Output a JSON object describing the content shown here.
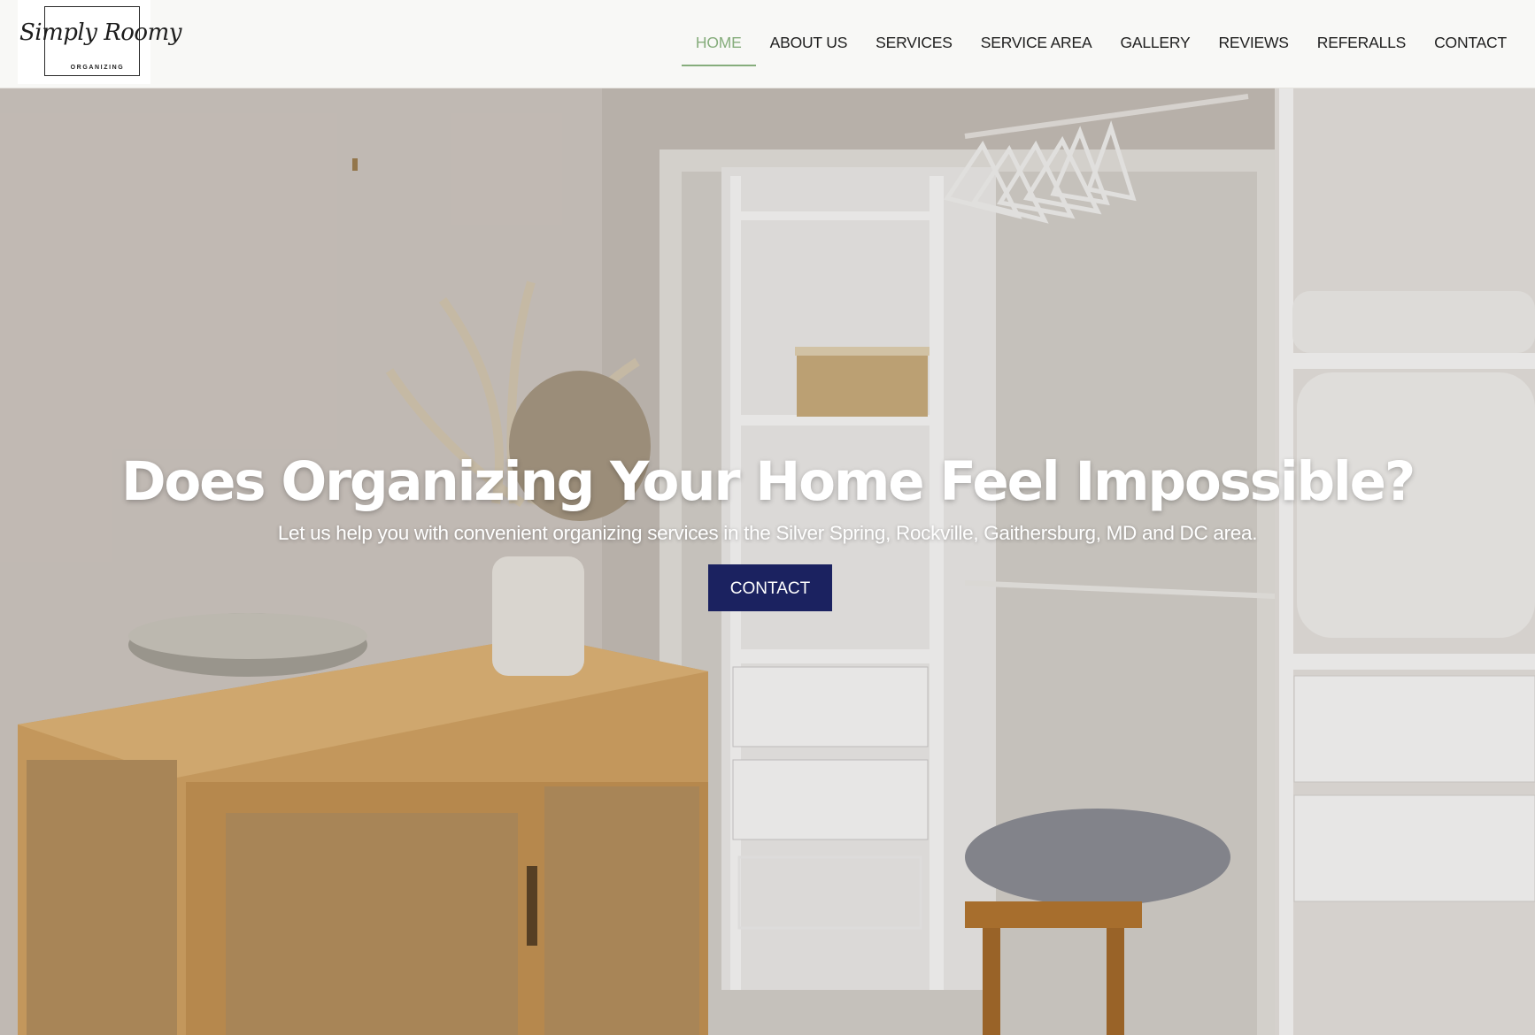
{
  "logo": {
    "script_text": "Simply Roomy",
    "sub_text": "ORGANIZING"
  },
  "nav": {
    "items": [
      "HOME",
      "ABOUT US",
      "SERVICES",
      "SERVICE AREA",
      "GALLERY",
      "REVIEWS",
      "REFERALLS",
      "CONTACT"
    ],
    "active": "HOME",
    "active_color": "#86ad7c"
  },
  "hero": {
    "title": "Does Organizing Your Home Feel Impossible?",
    "subtitle": "Let us help you with convenient organizing services in the Silver Spring, Rockville, Gaithersburg, MD and DC area.",
    "button_label": "CONTACT",
    "button_color": "#1b2260"
  }
}
